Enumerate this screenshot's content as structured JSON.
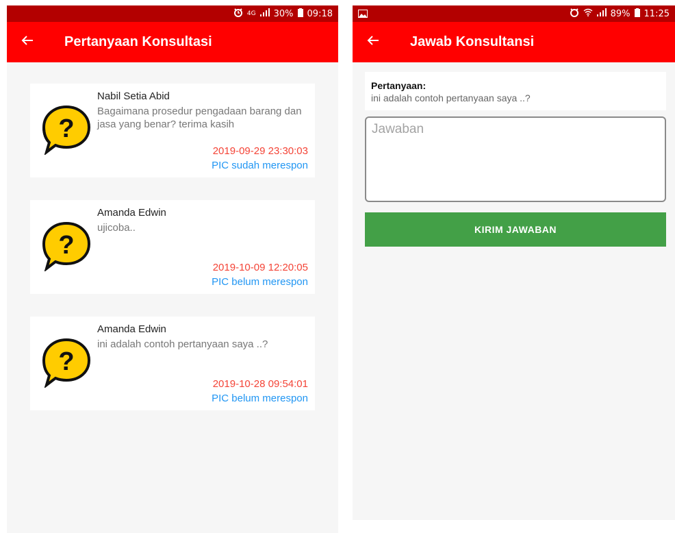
{
  "left_screen": {
    "status_bar": {
      "network": "4G",
      "battery": "30%",
      "time": "09:18"
    },
    "app_bar": {
      "title": "Pertanyaan Konsultasi",
      "back_icon": "arrow-left-icon"
    },
    "consultations": [
      {
        "name": "Nabil Setia Abid",
        "question": "Bagaimana prosedur pengadaan barang dan jasa yang benar? terima kasih",
        "timestamp": "2019-09-29 23:30:03",
        "status": "PIC sudah merespon"
      },
      {
        "name": "Amanda Edwin",
        "question": "ujicoba..",
        "timestamp": "2019-10-09 12:20:05",
        "status": "PIC belum merespon"
      },
      {
        "name": "Amanda Edwin",
        "question": "ini adalah contoh pertanyaan saya ..?",
        "timestamp": "2019-10-28 09:54:01",
        "status": "PIC belum merespon"
      }
    ]
  },
  "right_screen": {
    "status_bar": {
      "battery": "89%",
      "time": "11:25"
    },
    "app_bar": {
      "title": "Jawab Konsultansi",
      "back_icon": "arrow-left-icon"
    },
    "question_label": "Pertanyaan:",
    "question_text": "ini adalah contoh pertanyaan saya ..?",
    "answer_placeholder": "Jawaban",
    "submit_label": "KIRIM JAWABAN"
  },
  "colors": {
    "app_bar": "#ff0000",
    "status_bar": "#b30000",
    "timestamp": "#f44336",
    "status_link": "#2196f3",
    "submit_button": "#43a047",
    "question_icon": "#ffcc00"
  }
}
